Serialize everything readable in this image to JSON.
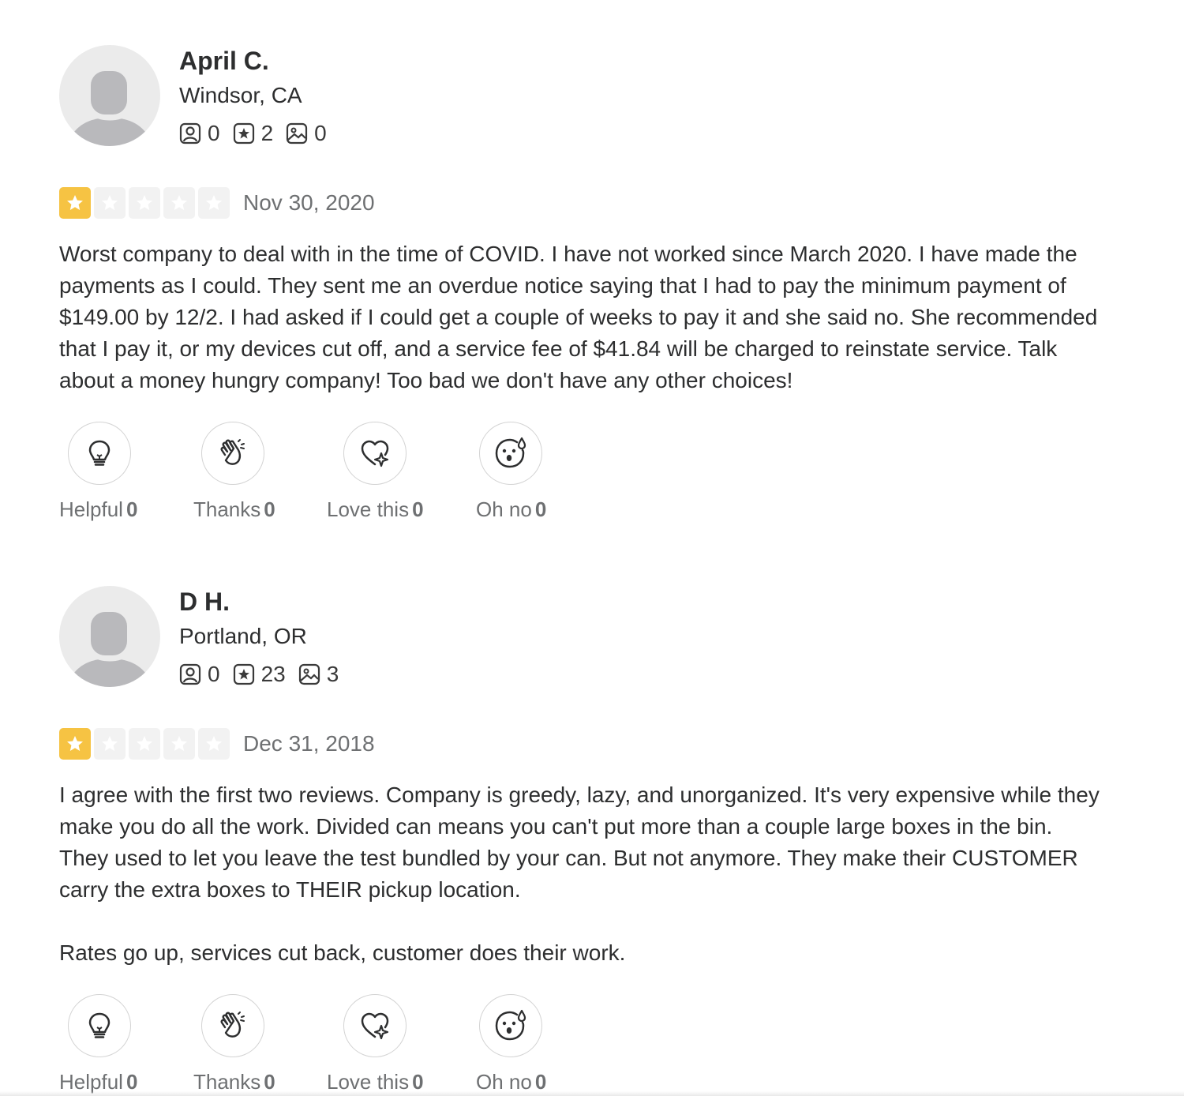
{
  "reviews": [
    {
      "name": "April C.",
      "location": "Windsor, CA",
      "stats": {
        "friends": "0",
        "reviews": "2",
        "photos": "0"
      },
      "rating": 1,
      "date": "Nov 30, 2020",
      "paragraphs": [
        "Worst company to deal with in the time of COVID. I have not worked since March 2020. I have made the payments as I could. They sent me an overdue notice saying that I had to pay the minimum payment of $149.00 by 12/2. I had asked if I could get a couple of weeks to pay it and she said no. She recommended that I pay it, or my devices cut off, and a service fee of $41.84 will be charged to reinstate service. Talk about a money hungry company! Too bad we don't have any other choices!"
      ],
      "reactions": {
        "helpful": {
          "label": "Helpful",
          "count": "0"
        },
        "thanks": {
          "label": "Thanks",
          "count": "0"
        },
        "love": {
          "label": "Love this",
          "count": "0"
        },
        "ohno": {
          "label": "Oh no",
          "count": "0"
        }
      }
    },
    {
      "name": "D H.",
      "location": "Portland, OR",
      "stats": {
        "friends": "0",
        "reviews": "23",
        "photos": "3"
      },
      "rating": 1,
      "date": "Dec 31, 2018",
      "paragraphs": [
        "I agree with the first two reviews. Company is greedy, lazy, and unorganized. It's very expensive while they make you do all the work. Divided can means you can't put more than a couple large boxes in the bin. They used to let you leave the test bundled by your can. But not anymore. They make their CUSTOMER carry the extra boxes to THEIR pickup location.",
        "Rates go up, services cut back, customer does their work."
      ],
      "reactions": {
        "helpful": {
          "label": "Helpful",
          "count": "0"
        },
        "thanks": {
          "label": "Thanks",
          "count": "0"
        },
        "love": {
          "label": "Love this",
          "count": "0"
        },
        "ohno": {
          "label": "Oh no",
          "count": "0"
        }
      }
    }
  ],
  "colors": {
    "star_filled": "#f6c343",
    "star_empty": "#f2f2f2",
    "text": "#2d2e2f",
    "muted": "#6e7072"
  },
  "icons": [
    "friends-icon",
    "review-star-icon",
    "photo-icon",
    "lightbulb-icon",
    "clapping-hands-icon",
    "heart-sparkle-icon",
    "surprised-face-icon"
  ]
}
